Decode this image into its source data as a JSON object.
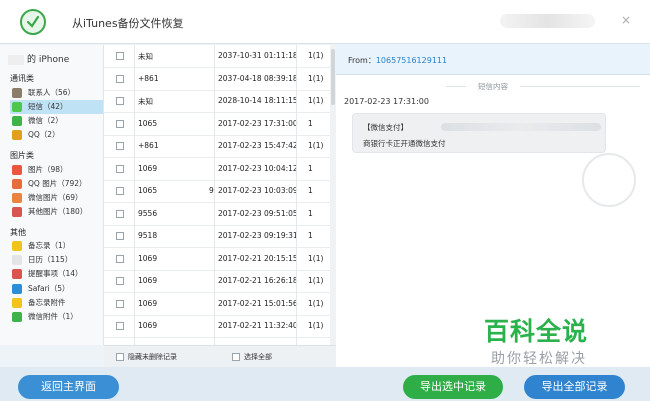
{
  "app": {
    "title": "从iTunes备份文件恢复",
    "close": "×"
  },
  "sidebar": {
    "device": "的 iPhone",
    "groups": [
      {
        "label": "通讯类",
        "items": [
          {
            "label": "联系人（56）",
            "icon": "contacts-icon",
            "color": "#8a7d6a"
          },
          {
            "label": "短信（42）",
            "icon": "sms-icon",
            "color": "#4cc94c",
            "selected": true
          },
          {
            "label": "微信（2）",
            "icon": "wechat-icon",
            "color": "#3db34a"
          },
          {
            "label": "QQ（2）",
            "icon": "qq-icon",
            "color": "#e0a21c"
          }
        ]
      },
      {
        "label": "图片类",
        "items": [
          {
            "label": "图片（98）",
            "icon": "photos-icon",
            "color": "#e9573f"
          },
          {
            "label": "QQ 图片（792）",
            "icon": "qq-photos-icon",
            "color": "#e96a3f"
          },
          {
            "label": "微信图片（69）",
            "icon": "wechat-photos-icon",
            "color": "#e9843f"
          },
          {
            "label": "其他图片（180）",
            "icon": "other-photos-icon",
            "color": "#d9534f"
          }
        ]
      },
      {
        "label": "其他",
        "items": [
          {
            "label": "备忘录（1）",
            "icon": "notes-icon",
            "color": "#f0c419"
          },
          {
            "label": "日历（115）",
            "icon": "calendar-icon",
            "color": "#e4e4e4"
          },
          {
            "label": "提醒事项（14）",
            "icon": "reminders-icon",
            "color": "#d9534f"
          },
          {
            "label": "Safari（5）",
            "icon": "safari-icon",
            "color": "#2a8fd6"
          },
          {
            "label": "备忘录附件",
            "icon": "notes-attachment-icon",
            "color": "#f0c419"
          },
          {
            "label": "微信附件（1）",
            "icon": "wechat-attachment-icon",
            "color": "#3db34a"
          }
        ]
      }
    ]
  },
  "messages": [
    {
      "from": "未知",
      "extra": "",
      "time": "2037-10-31 01:11:18",
      "count": "1(1)"
    },
    {
      "from": "+861",
      "extra": "",
      "time": "2037-04-18 08:39:18",
      "count": "1(1)"
    },
    {
      "from": "未知",
      "extra": "",
      "time": "2028-10-14 18:11:15",
      "count": "1(1)"
    },
    {
      "from": "1065",
      "extra": "",
      "time": "2017-02-23 17:31:00",
      "count": "1"
    },
    {
      "from": "+861",
      "extra": "",
      "time": "2017-02-23 15:47:42",
      "count": "1(1)"
    },
    {
      "from": "1069",
      "extra": "",
      "time": "2017-02-23 10:04:12",
      "count": "1"
    },
    {
      "from": "1065",
      "extra": "9",
      "time": "2017-02-23 10:03:09",
      "count": "1"
    },
    {
      "from": "9556",
      "extra": "",
      "time": "2017-02-23 09:51:05",
      "count": "1"
    },
    {
      "from": "9518",
      "extra": "",
      "time": "2017-02-23 09:19:31",
      "count": "1"
    },
    {
      "from": "1069",
      "extra": "",
      "time": "2017-02-21 20:15:15",
      "count": "1(1)"
    },
    {
      "from": "1069",
      "extra": "",
      "time": "2017-02-21 16:26:18",
      "count": "1(1)"
    },
    {
      "from": "1069",
      "extra": "",
      "time": "2017-02-21 15:01:56",
      "count": "1(1)"
    },
    {
      "from": "1069",
      "extra": "",
      "time": "2017-02-21 11:32:40",
      "count": "1(1)"
    }
  ],
  "list_footer": {
    "hide_undeleted": "隐藏未删除记录",
    "select_all": "选择全部"
  },
  "detail": {
    "from_label": "From：",
    "from_number": "10657516129111",
    "section_title": "短信内容",
    "time": "2017-02-23 17:31:00",
    "bubble_line1": "【微信支付】",
    "bubble_line2": "商银行卡正开通微信支付"
  },
  "buttons": {
    "back": "返回主界面",
    "export_selected": "导出选中记录",
    "export_all": "导出全部记录"
  },
  "watermark": {
    "main": "百科全说",
    "sub": "助你轻松解决"
  },
  "colors": {
    "accent": "#2a7fc9",
    "green": "#2fae47",
    "selected": "#bfe2f5"
  }
}
